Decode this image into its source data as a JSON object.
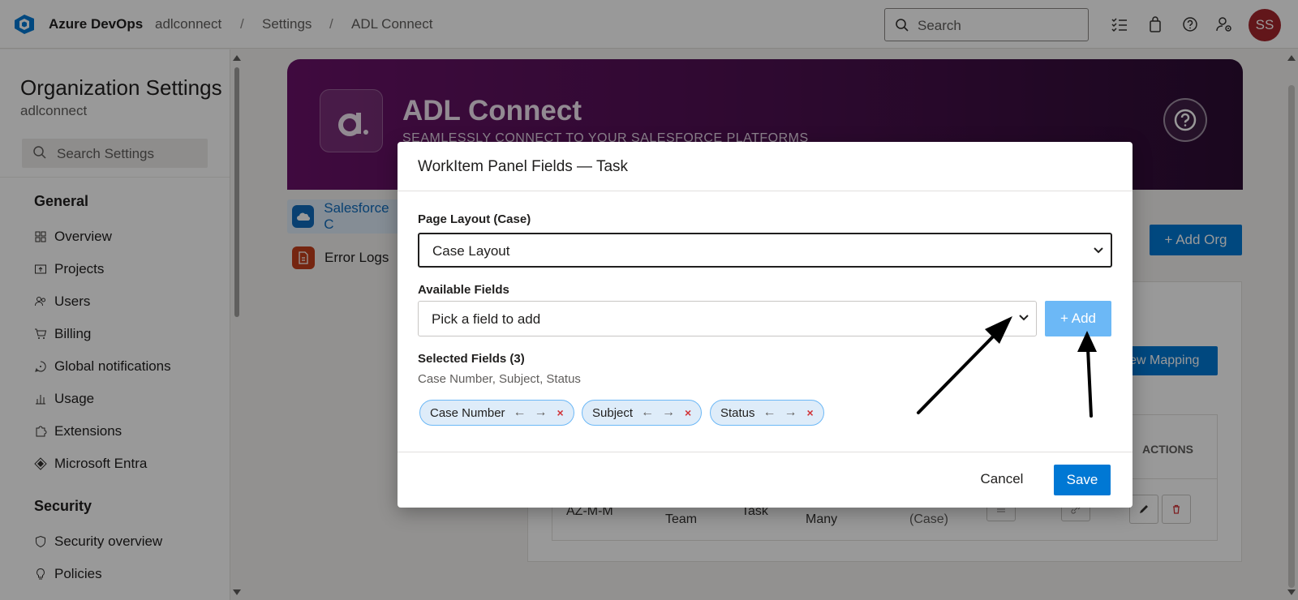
{
  "topbar": {
    "brand": "Azure DevOps",
    "breadcrumb": [
      "adlconnect",
      "Settings",
      "ADL Connect"
    ],
    "separator": "/",
    "search_placeholder": "Search",
    "avatar_initials": "SS"
  },
  "sidebar": {
    "title": "Organization Settings",
    "subtitle": "adlconnect",
    "search_placeholder": "Search Settings",
    "general_heading": "General",
    "general_items": [
      {
        "label": "Overview",
        "icon": "overview-icon"
      },
      {
        "label": "Projects",
        "icon": "projects-icon"
      },
      {
        "label": "Users",
        "icon": "users-icon"
      },
      {
        "label": "Billing",
        "icon": "cart-icon"
      },
      {
        "label": "Global notifications",
        "icon": "notification-icon"
      },
      {
        "label": "Usage",
        "icon": "chart-icon"
      },
      {
        "label": "Extensions",
        "icon": "puzzle-icon"
      },
      {
        "label": "Microsoft Entra",
        "icon": "entra-icon"
      }
    ],
    "security_heading": "Security",
    "security_items": [
      {
        "label": "Security overview",
        "icon": "shield-icon"
      },
      {
        "label": "Policies",
        "icon": "lightbulb-icon"
      }
    ]
  },
  "main": {
    "hero_title": "ADL Connect",
    "hero_subtitle": "SEAMLESSLY CONNECT TO YOUR SALESFORCE PLATFORMS",
    "nav": [
      {
        "label": "Salesforce C",
        "selected": true
      },
      {
        "label": "Error Logs",
        "selected": false
      }
    ],
    "add_org_label": "+ Add Org",
    "new_mapping_label": "New Mapping",
    "table": {
      "actions_header": "ACTIONS",
      "row": [
        "AZ-M-M",
        "Team",
        "Task",
        "Many",
        "(Case)"
      ]
    }
  },
  "modal": {
    "title": "WorkItem Panel Fields — Task",
    "page_layout_label": "Page Layout (Case)",
    "page_layout_value": "Case Layout",
    "available_label": "Available Fields",
    "available_placeholder": "Pick a field to add",
    "add_label": "+ Add",
    "selected_label": "Selected Fields (3)",
    "selected_summary": "Case Number, Subject, Status",
    "chips": [
      "Case Number",
      "Subject",
      "Status"
    ],
    "chip_left_arrow": "←",
    "chip_right_arrow": "→",
    "chip_remove": "×",
    "cancel_label": "Cancel",
    "save_label": "Save"
  },
  "colors": {
    "accent": "#0078d4",
    "add_disabled": "#6cb8f6",
    "hero_start": "#6a1269",
    "hero_end": "#2c0d33",
    "avatar": "#a4262c",
    "remove": "#d13438"
  }
}
